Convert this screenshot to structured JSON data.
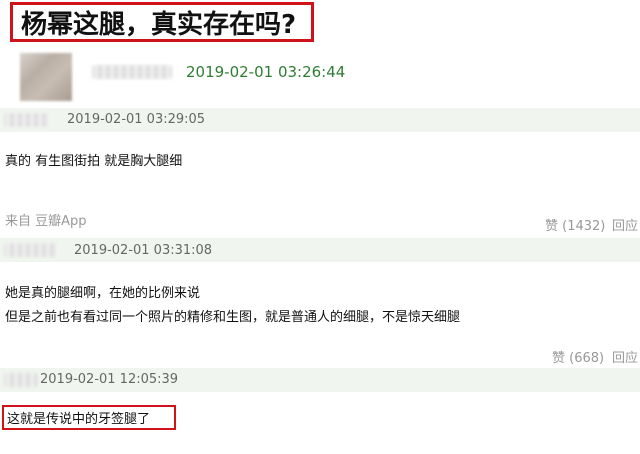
{
  "title": "杨幂这腿，真实存在吗?",
  "post": {
    "time": "2019-02-01 03:26:44"
  },
  "comments": [
    {
      "time": "2019-02-01 03:29:05",
      "lines": [
        "真的 有生图街拍 就是胸大腿细"
      ],
      "source": "来自 豆瓣App",
      "likes": "赞 (1432)",
      "reply": "回应"
    },
    {
      "time": "2019-02-01 03:31:08",
      "lines": [
        "她是真的腿细啊，在她的比例来说",
        "但是之前也有看过同一个照片的精修和生图，就是普通人的细腿，不是惊天细腿"
      ],
      "likes": "赞 (668)",
      "reply": "回应"
    },
    {
      "time": "2019-02-01 12:05:39",
      "lines": [
        "这就是传说中的牙签腿了"
      ]
    }
  ]
}
